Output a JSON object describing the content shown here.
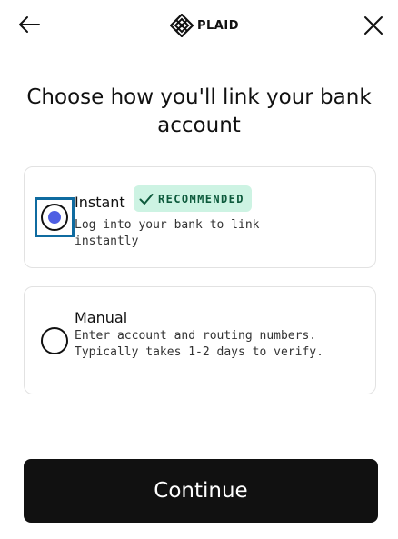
{
  "header": {
    "back_icon": "arrow-left-icon",
    "logo_icon": "plaid-logo-icon",
    "logo_text": "PLAID",
    "close_icon": "close-icon"
  },
  "title": "Choose how you'll link your bank account",
  "options": [
    {
      "label": "Instant",
      "badge": "RECOMMENDED",
      "badge_icon": "checkmark-icon",
      "description": "Log into your bank to link instantly",
      "selected": true
    },
    {
      "label": "Manual",
      "description": "Enter account and routing numbers. Typically takes 1-2 days to verify.",
      "selected": false
    }
  ],
  "continue_label": "Continue",
  "colors": {
    "accent": "#4f5fe3",
    "focus_ring": "#0f6ba0",
    "badge_bg": "#cdf3e3",
    "badge_text": "#0d5a3c",
    "button_bg": "#111111"
  }
}
